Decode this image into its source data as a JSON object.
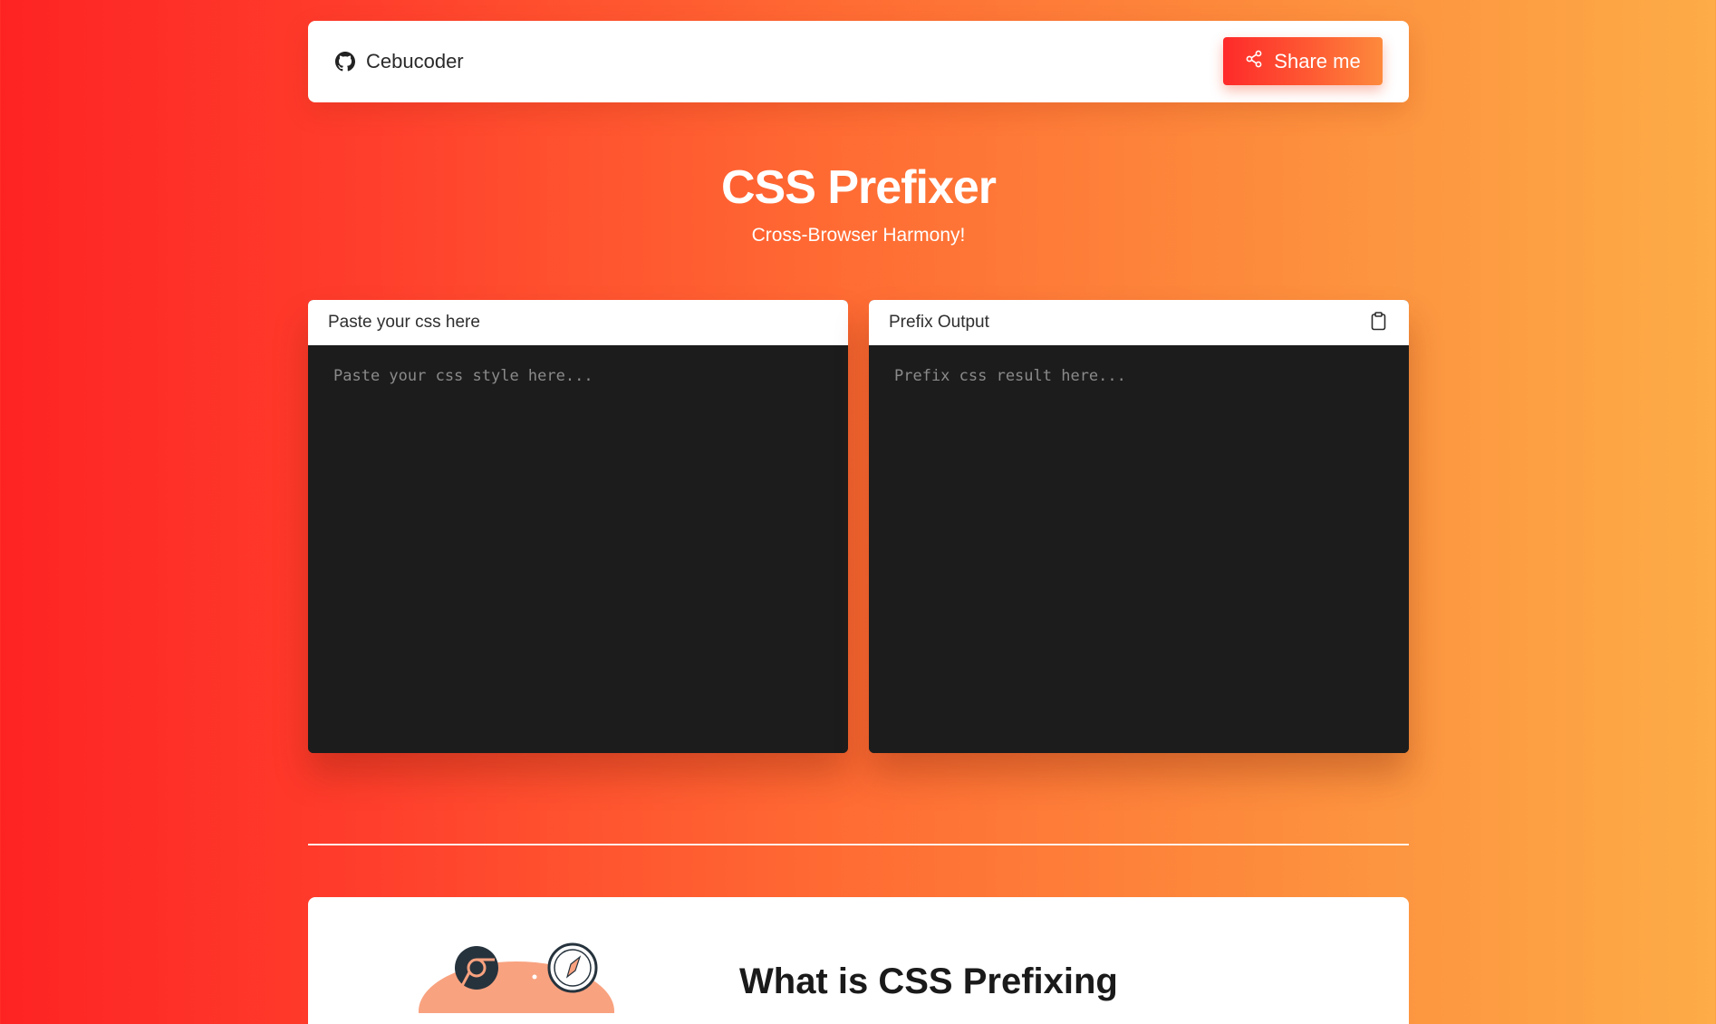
{
  "header": {
    "brand_label": "Cebucoder",
    "brand_icon": "github-icon",
    "share_label": "Share me",
    "share_icon": "share-icon"
  },
  "hero": {
    "title": "CSS Prefixer",
    "subtitle": "Cross-Browser Harmony!"
  },
  "input_panel": {
    "title": "Paste your css here",
    "placeholder": "Paste your css style here...",
    "value": ""
  },
  "output_panel": {
    "title": "Prefix Output",
    "placeholder": "Prefix css result here...",
    "value": "",
    "copy_icon": "clipboard-icon"
  },
  "info": {
    "title": "What is CSS Prefixing"
  },
  "colors": {
    "gradient_start": "#fe2323",
    "gradient_end": "#fdac47",
    "editor_bg": "#1c1c1c",
    "card_bg": "#ffffff"
  }
}
